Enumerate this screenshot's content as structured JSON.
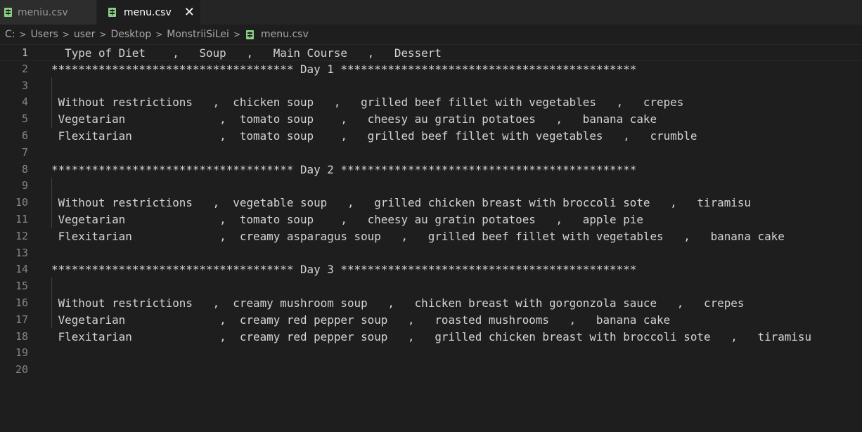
{
  "tabs": [
    {
      "label": "meniu.csv",
      "icon": "csv-file-icon",
      "active": false
    },
    {
      "label": "menu.csv",
      "icon": "csv-file-icon",
      "active": true,
      "close": "✕"
    }
  ],
  "breadcrumb": {
    "parts": [
      "C:",
      "Users",
      "user",
      "Desktop",
      "MonstriiSiLei"
    ],
    "separator": ">",
    "file": "menu.csv"
  },
  "editor": {
    "current_line": 1,
    "lines": [
      {
        "number": "1",
        "text": "  Type of Diet    ,   Soup   ,   Main Course   ,   Dessert"
      },
      {
        "number": "2",
        "text": "************************************ Day 1 ********************************************"
      },
      {
        "number": "3",
        "text": ""
      },
      {
        "number": "4",
        "text": " Without restrictions   ,  chicken soup   ,   grilled beef fillet with vegetables   ,   crepes"
      },
      {
        "number": "5",
        "text": " Vegetarian              ,  tomato soup    ,   cheesy au gratin potatoes   ,   banana cake"
      },
      {
        "number": "6",
        "text": " Flexitarian             ,  tomato soup    ,   grilled beef fillet with vegetables   ,   crumble"
      },
      {
        "number": "7",
        "text": ""
      },
      {
        "number": "8",
        "text": "************************************ Day 2 ********************************************"
      },
      {
        "number": "9",
        "text": ""
      },
      {
        "number": "10",
        "text": " Without restrictions   ,  vegetable soup   ,   grilled chicken breast with broccoli sote   ,   tiramisu"
      },
      {
        "number": "11",
        "text": " Vegetarian              ,  tomato soup    ,   cheesy au gratin potatoes   ,   apple pie"
      },
      {
        "number": "12",
        "text": " Flexitarian             ,  creamy asparagus soup   ,   grilled beef fillet with vegetables   ,   banana cake"
      },
      {
        "number": "13",
        "text": ""
      },
      {
        "number": "14",
        "text": "************************************ Day 3 ********************************************"
      },
      {
        "number": "15",
        "text": ""
      },
      {
        "number": "16",
        "text": " Without restrictions   ,  creamy mushroom soup   ,   chicken breast with gorgonzola sauce   ,   crepes"
      },
      {
        "number": "17",
        "text": " Vegetarian              ,  creamy red pepper soup   ,   roasted mushrooms   ,   banana cake"
      },
      {
        "number": "18",
        "text": " Flexitarian             ,  creamy red pepper soup   ,   grilled chicken breast with broccoli sote   ,   tiramisu"
      },
      {
        "number": "19",
        "text": ""
      },
      {
        "number": "20",
        "text": ""
      }
    ]
  },
  "colors": {
    "editor_background": "#1e1e1e",
    "tab_bar_background": "#252526",
    "inactive_tab": "#2d2d2d",
    "csv_icon": "#89d185",
    "line_number": "#858585",
    "text": "#d4d4d4"
  }
}
